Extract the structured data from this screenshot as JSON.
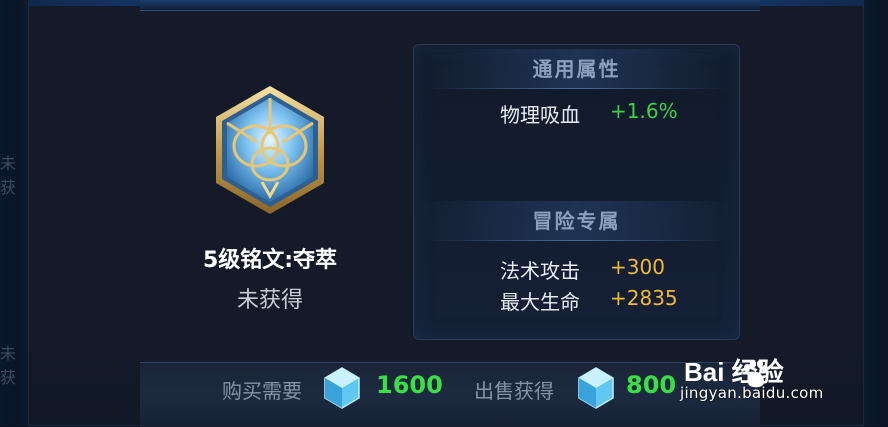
{
  "rune": {
    "title": "5级铭文:夺萃",
    "status": "未获得"
  },
  "attributes": {
    "general": {
      "header": "通用属性",
      "stats": [
        {
          "name": "物理吸血",
          "value": "+1.6%"
        }
      ]
    },
    "adventure": {
      "header": "冒险专属",
      "stats": [
        {
          "name": "法术攻击",
          "value": "+300"
        },
        {
          "name": "最大生命",
          "value": "+2835"
        }
      ]
    }
  },
  "price": {
    "buy_label": "购买需要",
    "buy_value": "1600",
    "sell_label": "出售获得",
    "sell_value": "800"
  },
  "side": {
    "left_text_1": "未获",
    "left_text_2": "未获"
  },
  "watermark": {
    "logo_text": "Bai 经验",
    "url": "jingyan.baidu.com"
  },
  "colors": {
    "positive_stat": "#3cd24a",
    "adventure_stat": "#f0b93a",
    "price_value": "#39e045",
    "background": "#141a27"
  }
}
